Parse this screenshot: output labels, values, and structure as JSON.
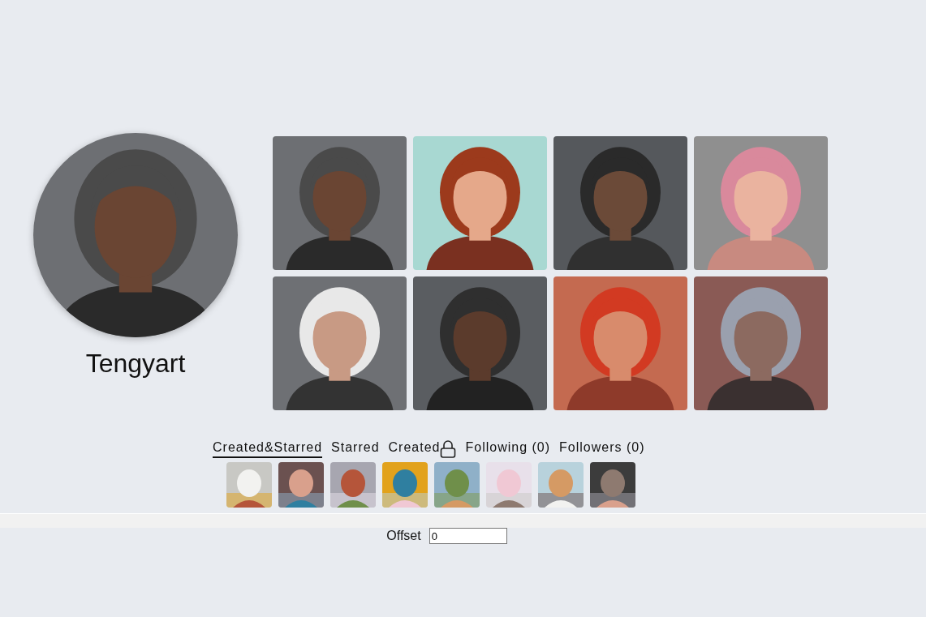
{
  "profile": {
    "name": "Tengyart"
  },
  "tabs": [
    {
      "label": "Created&Starred",
      "selected": true,
      "locked": false
    },
    {
      "label": "Starred",
      "selected": false,
      "locked": false
    },
    {
      "label": "Created",
      "selected": false,
      "locked": true
    },
    {
      "label": "Following (0)",
      "selected": false,
      "locked": false
    },
    {
      "label": "Followers (0)",
      "selected": false,
      "locked": false
    }
  ],
  "offset": {
    "label": "Offset",
    "value": "0"
  }
}
